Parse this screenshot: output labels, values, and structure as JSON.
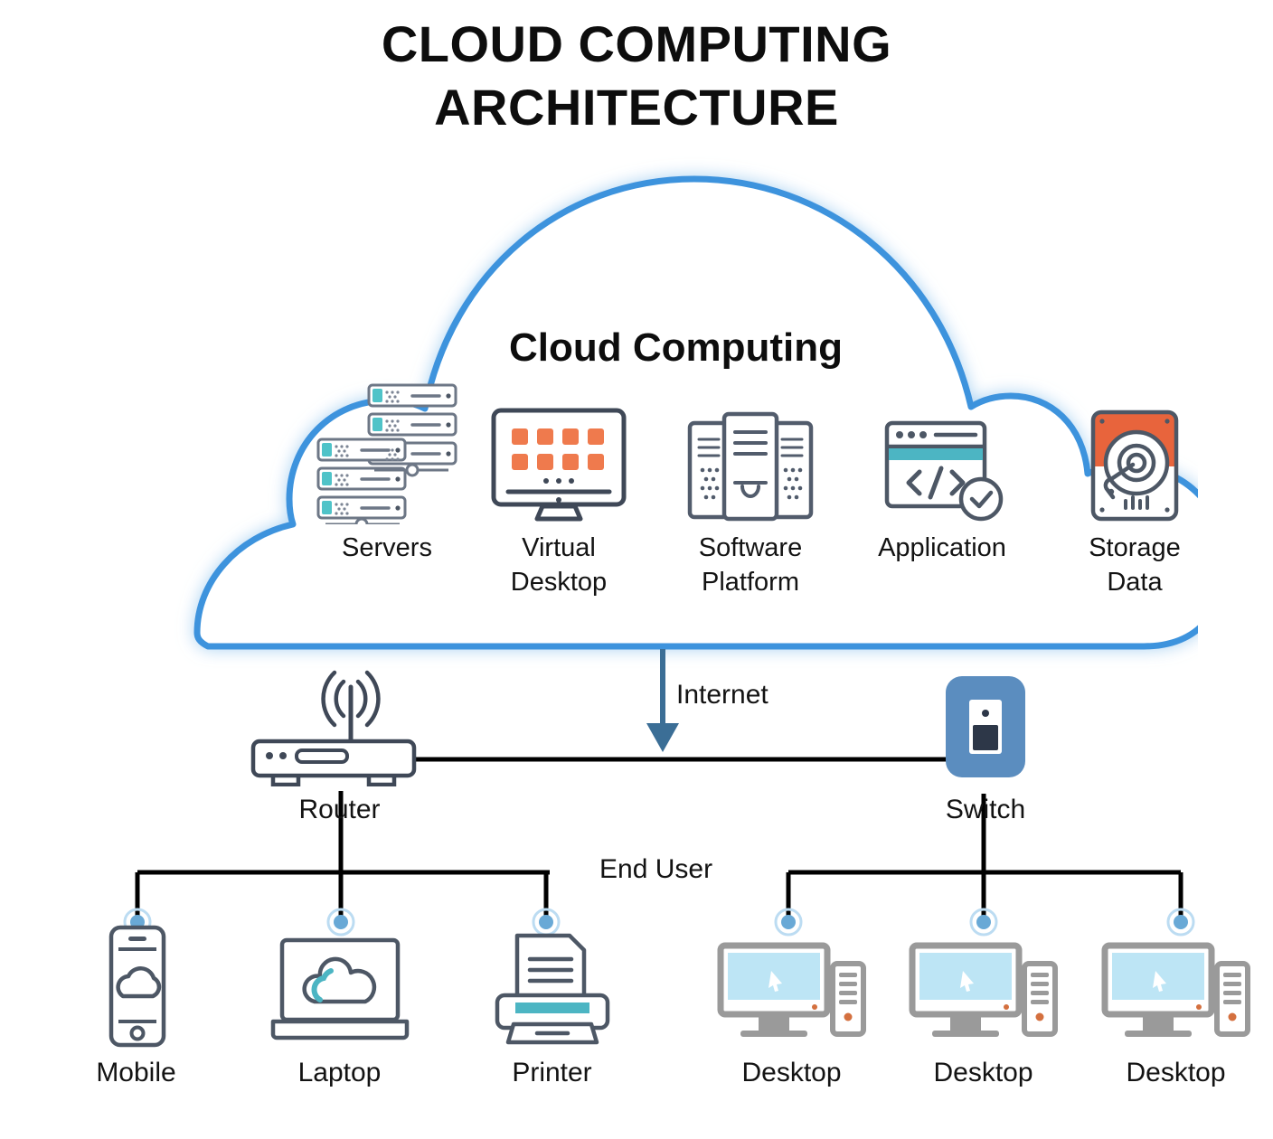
{
  "title": {
    "line1": "CLOUD COMPUTING",
    "line2": "ARCHITECTURE"
  },
  "cloud": {
    "heading": "Cloud Computing",
    "outline_color": "#3d93dd",
    "glow_color": "#cfe6f7",
    "services": [
      {
        "id": "servers",
        "label": "Servers",
        "icon": "servers-icon",
        "accent": "#4fc3c8"
      },
      {
        "id": "vdesktop",
        "label": "Virtual\nDesktop",
        "label_line1": "Virtual",
        "label_line2": "Desktop",
        "icon": "virtual-desktop-icon",
        "accent": "#ef7a4d"
      },
      {
        "id": "software",
        "label": "Software\nPlatform",
        "label_line1": "Software",
        "label_line2": "Platform",
        "icon": "software-platform-icon",
        "accent": "#495365"
      },
      {
        "id": "app",
        "label": "Application",
        "icon": "application-code-icon",
        "accent": "#4cb5c3"
      },
      {
        "id": "storage",
        "label": "Storage\nData",
        "label_line1": "Storage",
        "label_line2": "Data",
        "icon": "storage-disk-icon",
        "accent": "#e8643c"
      }
    ]
  },
  "network": {
    "router": {
      "label": "Router",
      "icon": "router-icon"
    },
    "switch": {
      "label": "Switch",
      "icon": "network-switch-icon",
      "color": "#5b8dbf"
    },
    "internet_label": "Internet",
    "internet_arrow_color": "#3b6e96",
    "end_user_label": "End User",
    "link_color": "#000000",
    "connector_dot_color": "#69a9d6"
  },
  "devices": [
    {
      "id": "mobile",
      "label": "Mobile",
      "icon": "mobile-phone-icon",
      "group": "router"
    },
    {
      "id": "laptop",
      "label": "Laptop",
      "icon": "laptop-icon",
      "group": "router"
    },
    {
      "id": "printer",
      "label": "Printer",
      "icon": "printer-icon",
      "group": "router"
    },
    {
      "id": "desk1",
      "label": "Desktop",
      "icon": "desktop-computer-icon",
      "group": "switch"
    },
    {
      "id": "desk2",
      "label": "Desktop",
      "icon": "desktop-computer-icon",
      "group": "switch"
    },
    {
      "id": "desk3",
      "label": "Desktop",
      "icon": "desktop-computer-icon",
      "group": "switch"
    }
  ],
  "palette": {
    "outline_dark": "#495365",
    "teal": "#4cb5c3",
    "orange": "#ef7a4d",
    "blue": "#3d93dd",
    "screen_blue": "#bde5f5",
    "gray": "#9a9a9a"
  }
}
